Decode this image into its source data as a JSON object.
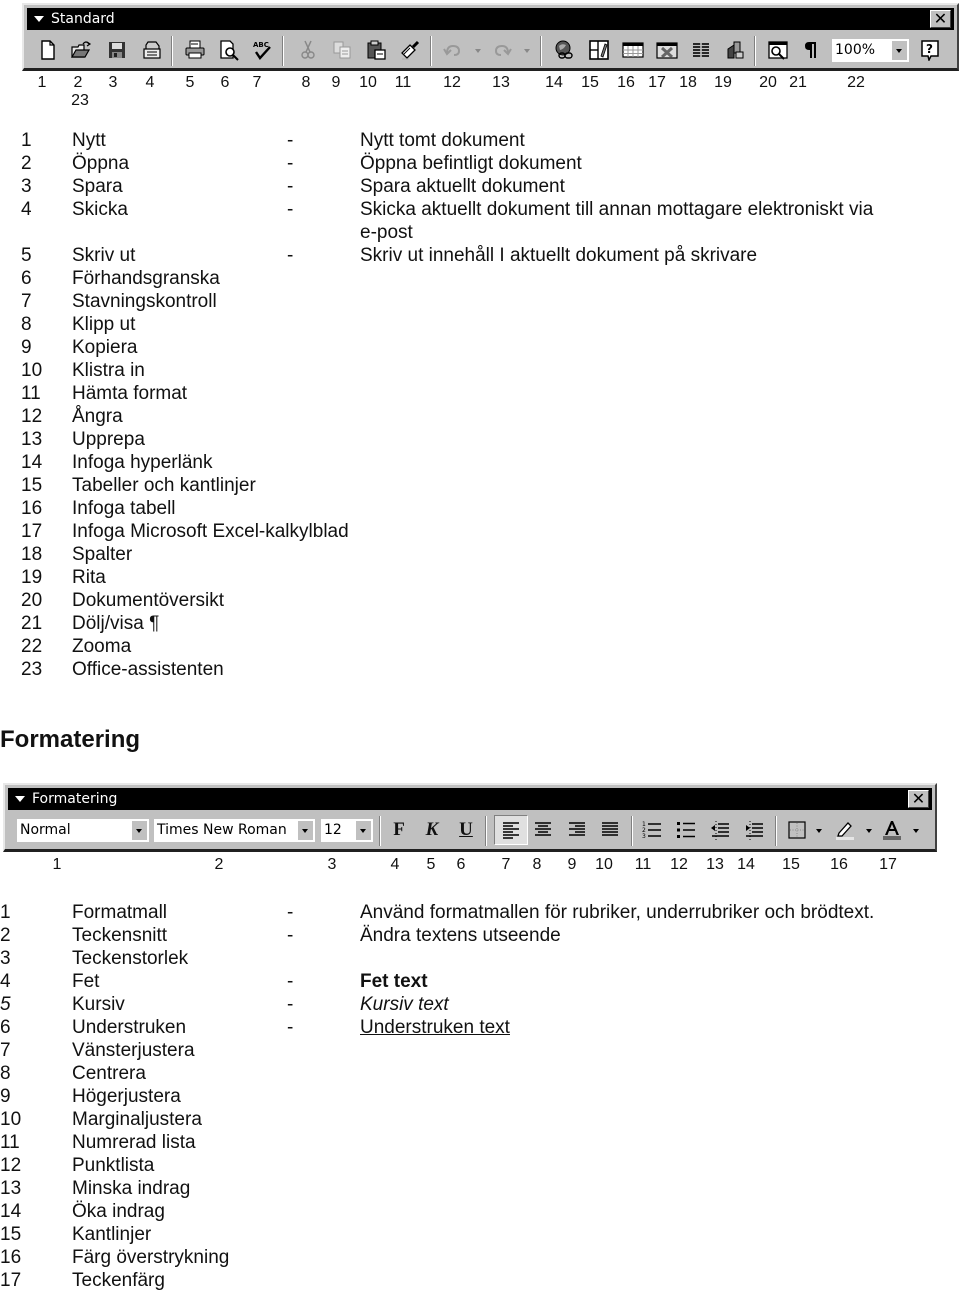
{
  "standard_toolbar": {
    "title": "Standard",
    "close_label": "✕",
    "zoom_value": "100%",
    "buttons": [
      {
        "n": "1",
        "icon": "new-document-icon"
      },
      {
        "n": "2",
        "icon": "open-folder-icon"
      },
      {
        "n": "3",
        "icon": "save-disk-icon"
      },
      {
        "n": "4",
        "icon": "send-mail-icon"
      },
      {
        "n": "5",
        "icon": "printer-icon"
      },
      {
        "n": "6",
        "icon": "print-preview-icon"
      },
      {
        "n": "7",
        "icon": "spellcheck-abc-icon"
      },
      {
        "n": "8",
        "icon": "scissors-icon"
      },
      {
        "n": "9",
        "icon": "copy-icon"
      },
      {
        "n": "10",
        "icon": "paste-clipboard-icon"
      },
      {
        "n": "11",
        "icon": "format-painter-icon"
      },
      {
        "n": "12",
        "icon": "undo-icon"
      },
      {
        "n": "13",
        "icon": "redo-icon"
      },
      {
        "n": "14",
        "icon": "hyperlink-globe-icon"
      },
      {
        "n": "15",
        "icon": "tables-borders-icon"
      },
      {
        "n": "16",
        "icon": "insert-table-icon"
      },
      {
        "n": "17",
        "icon": "insert-excel-sheet-icon"
      },
      {
        "n": "18",
        "icon": "columns-icon"
      },
      {
        "n": "19",
        "icon": "drawing-icon"
      },
      {
        "n": "20",
        "icon": "document-map-icon"
      },
      {
        "n": "21",
        "icon": "pilcrow-icon"
      },
      {
        "n": "22",
        "icon": "zoom-combo"
      },
      {
        "n": "23",
        "icon": "office-assistant-help-icon"
      }
    ],
    "numbers_row": [
      "1",
      "2",
      "3",
      "4",
      "5",
      "6",
      "7",
      "8",
      "9",
      "10",
      "11",
      "12",
      "13",
      "14",
      "15",
      "16",
      "17",
      "18",
      "19",
      "20",
      "21",
      "22",
      "23"
    ]
  },
  "standard_list": [
    {
      "num": "1",
      "name": "Nytt",
      "dash": "-",
      "desc": "Nytt tomt dokument"
    },
    {
      "num": "2",
      "name": "Öppna",
      "dash": "-",
      "desc": "Öppna befintligt dokument"
    },
    {
      "num": "3",
      "name": "Spara",
      "dash": "-",
      "desc": "Spara aktuellt dokument"
    },
    {
      "num": "4",
      "name": "Skicka",
      "dash": "-",
      "desc": "Skicka aktuellt dokument till annan mottagare elektroniskt via",
      "desc_cont": "e-post"
    },
    {
      "num": "5",
      "name": "Skriv ut",
      "dash": "-",
      "desc": "Skriv ut innehåll I aktuellt dokument på skrivare"
    },
    {
      "num": "6",
      "name": "Förhandsgranska"
    },
    {
      "num": "7",
      "name": "Stavningskontroll"
    },
    {
      "num": "8",
      "name": "Klipp ut"
    },
    {
      "num": "9",
      "name": "Kopiera"
    },
    {
      "num": "10",
      "name": "Klistra in"
    },
    {
      "num": "11",
      "name": "Hämta format"
    },
    {
      "num": "12",
      "name": "Ångra"
    },
    {
      "num": "13",
      "name": "Upprepa"
    },
    {
      "num": "14",
      "name": "Infoga hyperlänk"
    },
    {
      "num": "15",
      "name": "Tabeller och kantlinjer"
    },
    {
      "num": "16",
      "name": "Infoga tabell"
    },
    {
      "num": "17",
      "name": "Infoga Microsoft Excel-kalkylblad"
    },
    {
      "num": "18",
      "name": "Spalter"
    },
    {
      "num": "19",
      "name": "Rita"
    },
    {
      "num": "20",
      "name": "Dokumentöversikt"
    },
    {
      "num": "21",
      "name": "Dölj/visa ¶"
    },
    {
      "num": "22",
      "name": "Zooma"
    },
    {
      "num": "23",
      "name": "Office-assistenten"
    }
  ],
  "formatting_heading": "Formatering",
  "formatting_toolbar": {
    "title": "Formatering",
    "close_label": "✕",
    "style_value": "Normal",
    "font_value": "Times New Roman",
    "size_value": "12",
    "bold_label": "F",
    "italic_label": "K",
    "underline_label": "U",
    "buttons": [
      {
        "n": "4",
        "icon": "bold-icon"
      },
      {
        "n": "5",
        "icon": "italic-icon"
      },
      {
        "n": "6",
        "icon": "underline-icon"
      },
      {
        "n": "7",
        "icon": "align-left-icon",
        "pressed": true
      },
      {
        "n": "8",
        "icon": "align-center-icon"
      },
      {
        "n": "9",
        "icon": "align-right-icon"
      },
      {
        "n": "10",
        "icon": "justify-icon"
      },
      {
        "n": "11",
        "icon": "numbered-list-icon"
      },
      {
        "n": "12",
        "icon": "bulleted-list-icon"
      },
      {
        "n": "13",
        "icon": "decrease-indent-icon"
      },
      {
        "n": "14",
        "icon": "increase-indent-icon"
      },
      {
        "n": "15",
        "icon": "borders-icon"
      },
      {
        "n": "16",
        "icon": "highlight-icon"
      },
      {
        "n": "17",
        "icon": "font-color-icon"
      }
    ],
    "numbers_row": [
      "1",
      "2",
      "3",
      "4",
      "5",
      "6",
      "7",
      "8",
      "9",
      "10",
      "11",
      "12",
      "13",
      "14",
      "15",
      "16",
      "17"
    ]
  },
  "formatting_list": [
    {
      "num": "1",
      "name": "Formatmall",
      "dash": "-",
      "desc": "Använd formatmallen för rubriker, underrubriker och brödtext."
    },
    {
      "num": "2",
      "name": "Teckensnitt",
      "dash": "-",
      "desc": "Ändra textens utseende"
    },
    {
      "num": "3",
      "name": "Teckenstorlek"
    },
    {
      "num": "4",
      "name": "Fet",
      "dash": "-",
      "desc": "Fet text",
      "style": "bold"
    },
    {
      "num": "5",
      "name": "Kursiv",
      "dash": "-",
      "desc": "Kursiv text",
      "style": "italic",
      "num_style": "italic"
    },
    {
      "num": "6",
      "name": "Understruken",
      "dash": "-",
      "desc": "Understruken text",
      "style": "underline"
    },
    {
      "num": "7",
      "name": "Vänsterjustera"
    },
    {
      "num": "8",
      "name": "Centrera"
    },
    {
      "num": "9",
      "name": "Högerjustera"
    },
    {
      "num": "10",
      "name": "Marginaljustera"
    },
    {
      "num": "11",
      "name": "Numrerad lista"
    },
    {
      "num": "12",
      "name": "Punktlista"
    },
    {
      "num": "13",
      "name": "Minska indrag"
    },
    {
      "num": "14",
      "name": "Öka indrag"
    },
    {
      "num": "15",
      "name": "Kantlinjer"
    },
    {
      "num": "16",
      "name": "Färg överstrykning"
    },
    {
      "num": "17",
      "name": "Teckenfärg"
    }
  ]
}
